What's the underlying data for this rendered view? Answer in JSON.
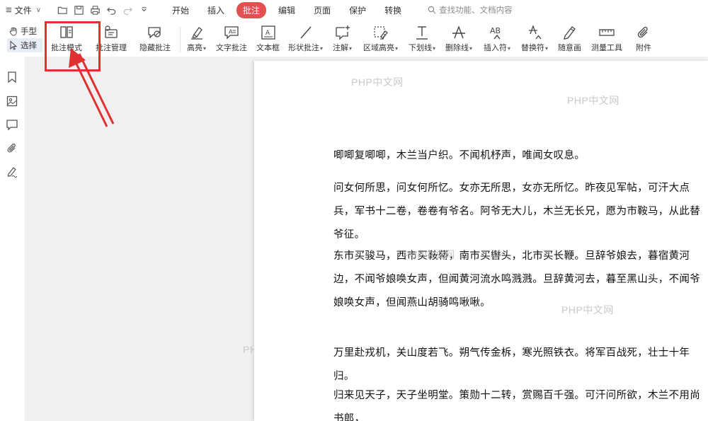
{
  "menubar": {
    "file_label": "文件",
    "tabs": [
      {
        "label": "开始",
        "active": false
      },
      {
        "label": "插入",
        "active": false
      },
      {
        "label": "批注",
        "active": true
      },
      {
        "label": "编辑",
        "active": false
      },
      {
        "label": "页面",
        "active": false
      },
      {
        "label": "保护",
        "active": false
      },
      {
        "label": "转换",
        "active": false
      }
    ],
    "search_placeholder": "查找功能、文档内容",
    "accent_color": "#e25151"
  },
  "ribbon": {
    "hand_label": "手型",
    "select_label": "选择",
    "items": [
      {
        "label": "批注模式",
        "icon": "annotation-mode-icon"
      },
      {
        "label": "批注管理",
        "icon": "annotation-manage-icon"
      },
      {
        "label": "隐藏批注",
        "icon": "hide-annotation-icon"
      },
      {
        "label": "高亮",
        "icon": "highlight-icon",
        "dropdown": true
      },
      {
        "label": "文字批注",
        "icon": "text-annotation-icon"
      },
      {
        "label": "文本框",
        "icon": "textbox-icon"
      },
      {
        "label": "形状批注",
        "icon": "shape-annotation-icon",
        "dropdown": true
      },
      {
        "label": "注解",
        "icon": "note-icon",
        "dropdown": true
      },
      {
        "label": "区域高亮",
        "icon": "area-highlight-icon",
        "dropdown": true
      },
      {
        "label": "下划线",
        "icon": "underline-icon",
        "dropdown": true
      },
      {
        "label": "删除线",
        "icon": "strikethrough-icon",
        "dropdown": true
      },
      {
        "label": "插入符",
        "icon": "insert-caret-icon",
        "dropdown": true
      },
      {
        "label": "替换符",
        "icon": "replace-caret-icon",
        "dropdown": true
      },
      {
        "label": "随意画",
        "icon": "freehand-icon"
      },
      {
        "label": "测量工具",
        "icon": "ruler-icon"
      },
      {
        "label": "附件",
        "icon": "paperclip-icon"
      }
    ]
  },
  "document": {
    "paragraphs": [
      "唧唧复唧唧，木兰当户织。不闻机杼声，唯闻女叹息。",
      "问女何所思，问女何所忆。女亦无所思，女亦无所忆。昨夜见军帖，可汗大点兵，军书十二卷，卷卷有爷名。阿爷无大儿，木兰无长兄，愿为市鞍马，从此替爷征。",
      "东市买骏马，西市买鞍鞯，南市买辔头，北市买长鞭。旦辞爷娘去，暮宿黄河边，不闻爷娘唤女声，但闻黄河流水鸣溅溅。旦辞黄河去，暮至黑山头，不闻爷娘唤女声，但闻燕山胡骑鸣啾啾。",
      "万里赴戎机，关山度若飞。朔气传金柝，寒光照铁衣。将军百战死，壮士十年归。",
      "归来见天子，天子坐明堂。策勋十二转，赏赐百千强。可汗问所欲，木兰不用尚书郎，"
    ]
  },
  "watermark_text": "PHP中文网",
  "annotation_color": "#e03030"
}
